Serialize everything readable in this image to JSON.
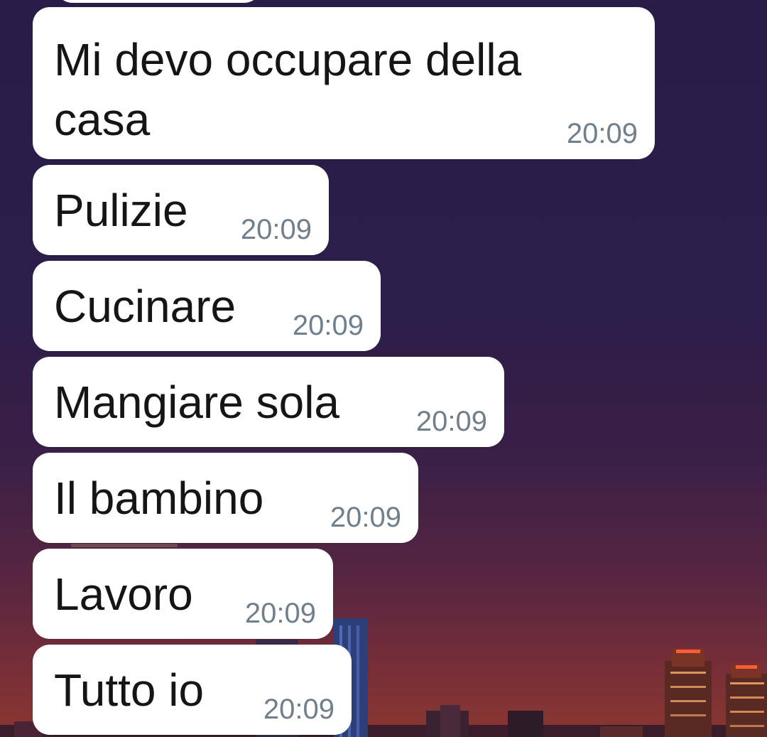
{
  "chat": {
    "messages": [
      {
        "text": "Mi devo occupare della\ncasa",
        "time": "20:09"
      },
      {
        "text": "Pulizie",
        "time": "20:09"
      },
      {
        "text": "Cucinare",
        "time": "20:09"
      },
      {
        "text": "Mangiare sola",
        "time": "20:09"
      },
      {
        "text": "Il bambino",
        "time": "20:09"
      },
      {
        "text": "Lavoro",
        "time": "20:09"
      },
      {
        "text": "Tutto io",
        "time": "20:09"
      }
    ]
  },
  "colors": {
    "bubble": "#ffffff",
    "message_text": "#151515",
    "timestamp": "#6f7f8b",
    "wallpaper_top": "#2a1c49",
    "wallpaper_bottom": "#8a3730"
  }
}
